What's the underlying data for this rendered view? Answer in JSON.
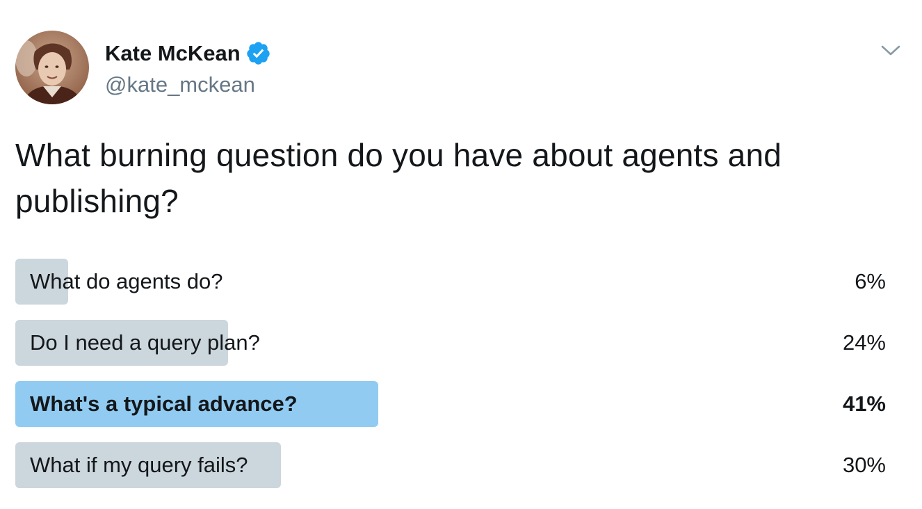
{
  "author": {
    "name": "Kate McKean",
    "handle": "@kate_mckean",
    "verified": true,
    "verified_icon": "verified-badge-icon",
    "verified_color": "#1da1f2"
  },
  "menu": {
    "icon": "chevron-down-icon"
  },
  "tweet": {
    "text": "What burning question do you have about agents and publishing?"
  },
  "poll": {
    "choices": [
      {
        "label": "What do agents do?",
        "percent_text": "6%",
        "percent": 6,
        "leading": false
      },
      {
        "label": "Do I need a query plan?",
        "percent_text": "24%",
        "percent": 24,
        "leading": false
      },
      {
        "label": "What's a typical advance?",
        "percent_text": "41%",
        "percent": 41,
        "leading": true
      },
      {
        "label": "What if my query fails?",
        "percent_text": "30%",
        "percent": 30,
        "leading": false
      }
    ],
    "bar_color": "#ccd6dd",
    "leading_bar_color": "#91cbf1"
  }
}
